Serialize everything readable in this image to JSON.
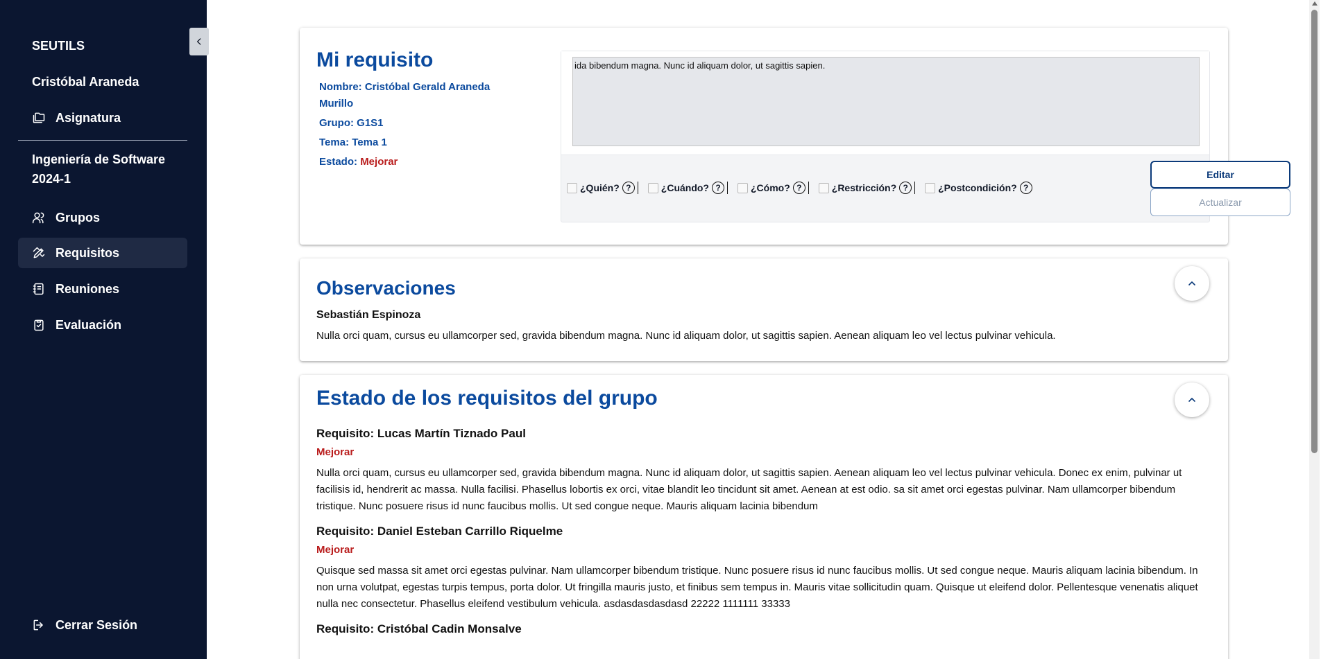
{
  "sidebar": {
    "brand": "SEUTILS",
    "user": "Cristóbal Araneda",
    "subject_label": "Asignatura",
    "course": "Ingeniería de Software 2024-1",
    "items": [
      {
        "label": "Grupos",
        "icon": "users-icon"
      },
      {
        "label": "Requisitos",
        "icon": "pen-ruler-icon",
        "active": true
      },
      {
        "label": "Reuniones",
        "icon": "notebook-icon"
      },
      {
        "label": "Evaluación",
        "icon": "clipboard-check-icon"
      }
    ],
    "logout": "Cerrar Sesión"
  },
  "my_requirement": {
    "title": "Mi requisito",
    "name_label": "Nombre:",
    "name_value": "Cristóbal Gerald Araneda Murillo",
    "group_label": "Grupo:",
    "group_value": "G1S1",
    "topic_label": "Tema:",
    "topic_value": "Tema 1",
    "status_label": "Estado:",
    "status_value": "Mejorar",
    "text": "ida bibendum magna. Nunc id aliquam dolor, ut sagittis sapien.",
    "checks": [
      {
        "label": "¿Quién?"
      },
      {
        "label": "¿Cuándo?"
      },
      {
        "label": "¿Cómo?"
      },
      {
        "label": "¿Restricción?"
      },
      {
        "label": "¿Postcondición?"
      }
    ],
    "help_glyph": "?",
    "edit_label": "Editar",
    "update_label": "Actualizar"
  },
  "observations": {
    "title": "Observaciones",
    "author": "Sebastián Espinoza",
    "text": "Nulla orci quam, cursus eu ullamcorper sed, gravida bibendum magna. Nunc id aliquam dolor, ut sagittis sapien. Aenean aliquam leo vel lectus pulvinar vehicula."
  },
  "group_status": {
    "title": "Estado de los requisitos del grupo",
    "requirements": [
      {
        "name": "Requisito: Lucas Martín Tiznado Paul",
        "status": "Mejorar",
        "text": "Nulla orci quam, cursus eu ullamcorper sed, gravida bibendum magna. Nunc id aliquam dolor, ut sagittis sapien. Aenean aliquam leo vel lectus pulvinar vehicula. Donec ex enim, pulvinar ut facilisis id, hendrerit ac massa. Nulla facilisi. Phasellus lobortis ex orci, vitae blandit leo tincidunt sit amet. Aenean at est odio. sa sit amet orci egestas pulvinar. Nam ullamcorper bibendum tristique. Nunc posuere risus id nunc faucibus mollis. Ut sed congue neque. Mauris aliquam lacinia bibendum"
      },
      {
        "name": "Requisito: Daniel Esteban Carrillo Riquelme",
        "status": "Mejorar",
        "text": "Quisque sed massa sit amet orci egestas pulvinar. Nam ullamcorper bibendum tristique. Nunc posuere risus id nunc faucibus mollis. Ut sed congue neque. Mauris aliquam lacinia bibendum. In non urna volutpat, egestas turpis tempus, porta dolor. Ut fringilla mauris justo, et finibus sem tempus in. Mauris vitae sollicitudin quam. Quisque ut eleifend dolor. Pellentesque venenatis aliquet nulla nec consectetur. Phasellus eleifend vestibulum vehicula. asdasdasdasdasd 22222 1111111 33333"
      },
      {
        "name": "Requisito: Cristóbal Cadin Monsalve"
      }
    ]
  },
  "colors": {
    "sidebar_bg": "#0b1630",
    "accent_blue": "#0b4a9e",
    "status_red": "#b91c1c"
  }
}
